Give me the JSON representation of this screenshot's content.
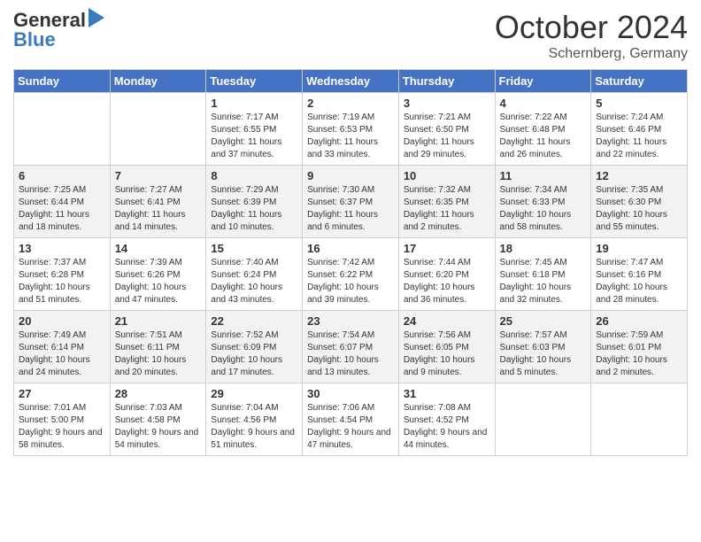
{
  "header": {
    "logo_general": "General",
    "logo_blue": "Blue",
    "title": "October 2024",
    "location": "Schernberg, Germany"
  },
  "days_of_week": [
    "Sunday",
    "Monday",
    "Tuesday",
    "Wednesday",
    "Thursday",
    "Friday",
    "Saturday"
  ],
  "weeks": [
    [
      {
        "day": "",
        "content": ""
      },
      {
        "day": "",
        "content": ""
      },
      {
        "day": "1",
        "content": "Sunrise: 7:17 AM\nSunset: 6:55 PM\nDaylight: 11 hours and 37 minutes."
      },
      {
        "day": "2",
        "content": "Sunrise: 7:19 AM\nSunset: 6:53 PM\nDaylight: 11 hours and 33 minutes."
      },
      {
        "day": "3",
        "content": "Sunrise: 7:21 AM\nSunset: 6:50 PM\nDaylight: 11 hours and 29 minutes."
      },
      {
        "day": "4",
        "content": "Sunrise: 7:22 AM\nSunset: 6:48 PM\nDaylight: 11 hours and 26 minutes."
      },
      {
        "day": "5",
        "content": "Sunrise: 7:24 AM\nSunset: 6:46 PM\nDaylight: 11 hours and 22 minutes."
      }
    ],
    [
      {
        "day": "6",
        "content": "Sunrise: 7:25 AM\nSunset: 6:44 PM\nDaylight: 11 hours and 18 minutes."
      },
      {
        "day": "7",
        "content": "Sunrise: 7:27 AM\nSunset: 6:41 PM\nDaylight: 11 hours and 14 minutes."
      },
      {
        "day": "8",
        "content": "Sunrise: 7:29 AM\nSunset: 6:39 PM\nDaylight: 11 hours and 10 minutes."
      },
      {
        "day": "9",
        "content": "Sunrise: 7:30 AM\nSunset: 6:37 PM\nDaylight: 11 hours and 6 minutes."
      },
      {
        "day": "10",
        "content": "Sunrise: 7:32 AM\nSunset: 6:35 PM\nDaylight: 11 hours and 2 minutes."
      },
      {
        "day": "11",
        "content": "Sunrise: 7:34 AM\nSunset: 6:33 PM\nDaylight: 10 hours and 58 minutes."
      },
      {
        "day": "12",
        "content": "Sunrise: 7:35 AM\nSunset: 6:30 PM\nDaylight: 10 hours and 55 minutes."
      }
    ],
    [
      {
        "day": "13",
        "content": "Sunrise: 7:37 AM\nSunset: 6:28 PM\nDaylight: 10 hours and 51 minutes."
      },
      {
        "day": "14",
        "content": "Sunrise: 7:39 AM\nSunset: 6:26 PM\nDaylight: 10 hours and 47 minutes."
      },
      {
        "day": "15",
        "content": "Sunrise: 7:40 AM\nSunset: 6:24 PM\nDaylight: 10 hours and 43 minutes."
      },
      {
        "day": "16",
        "content": "Sunrise: 7:42 AM\nSunset: 6:22 PM\nDaylight: 10 hours and 39 minutes."
      },
      {
        "day": "17",
        "content": "Sunrise: 7:44 AM\nSunset: 6:20 PM\nDaylight: 10 hours and 36 minutes."
      },
      {
        "day": "18",
        "content": "Sunrise: 7:45 AM\nSunset: 6:18 PM\nDaylight: 10 hours and 32 minutes."
      },
      {
        "day": "19",
        "content": "Sunrise: 7:47 AM\nSunset: 6:16 PM\nDaylight: 10 hours and 28 minutes."
      }
    ],
    [
      {
        "day": "20",
        "content": "Sunrise: 7:49 AM\nSunset: 6:14 PM\nDaylight: 10 hours and 24 minutes."
      },
      {
        "day": "21",
        "content": "Sunrise: 7:51 AM\nSunset: 6:11 PM\nDaylight: 10 hours and 20 minutes."
      },
      {
        "day": "22",
        "content": "Sunrise: 7:52 AM\nSunset: 6:09 PM\nDaylight: 10 hours and 17 minutes."
      },
      {
        "day": "23",
        "content": "Sunrise: 7:54 AM\nSunset: 6:07 PM\nDaylight: 10 hours and 13 minutes."
      },
      {
        "day": "24",
        "content": "Sunrise: 7:56 AM\nSunset: 6:05 PM\nDaylight: 10 hours and 9 minutes."
      },
      {
        "day": "25",
        "content": "Sunrise: 7:57 AM\nSunset: 6:03 PM\nDaylight: 10 hours and 5 minutes."
      },
      {
        "day": "26",
        "content": "Sunrise: 7:59 AM\nSunset: 6:01 PM\nDaylight: 10 hours and 2 minutes."
      }
    ],
    [
      {
        "day": "27",
        "content": "Sunrise: 7:01 AM\nSunset: 5:00 PM\nDaylight: 9 hours and 58 minutes."
      },
      {
        "day": "28",
        "content": "Sunrise: 7:03 AM\nSunset: 4:58 PM\nDaylight: 9 hours and 54 minutes."
      },
      {
        "day": "29",
        "content": "Sunrise: 7:04 AM\nSunset: 4:56 PM\nDaylight: 9 hours and 51 minutes."
      },
      {
        "day": "30",
        "content": "Sunrise: 7:06 AM\nSunset: 4:54 PM\nDaylight: 9 hours and 47 minutes."
      },
      {
        "day": "31",
        "content": "Sunrise: 7:08 AM\nSunset: 4:52 PM\nDaylight: 9 hours and 44 minutes."
      },
      {
        "day": "",
        "content": ""
      },
      {
        "day": "",
        "content": ""
      }
    ]
  ]
}
